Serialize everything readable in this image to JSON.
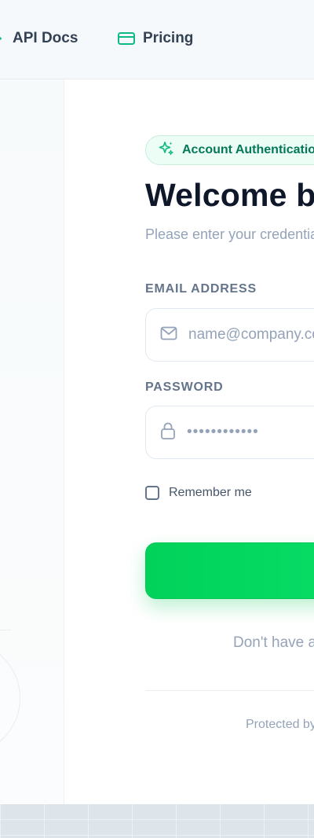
{
  "nav": {
    "docs": {
      "label": "API Docs",
      "icon": "chevron-right-icon"
    },
    "pricing": {
      "label": "Pricing",
      "icon": "credit-card-icon"
    }
  },
  "badge": {
    "text": "Account Authentication",
    "icon": "sparkles-icon"
  },
  "title": "Welcome back",
  "subtitle": "Please enter your credentials",
  "email": {
    "label": "EMAIL ADDRESS",
    "placeholder": "name@company.com",
    "icon": "mail-icon"
  },
  "password": {
    "label": "PASSWORD",
    "value": "••••••••••••",
    "icon": "lock-icon"
  },
  "remember": {
    "label": "Remember me",
    "checked": false
  },
  "signup_text": "Don't have an account?",
  "protected_text": "Protected by",
  "colors": {
    "accent": "#00d25a",
    "badge_text": "#047857",
    "badge_bg": "#ecfdf5",
    "muted": "#94a3b8",
    "label": "#64748b",
    "heading": "#0f172a"
  }
}
